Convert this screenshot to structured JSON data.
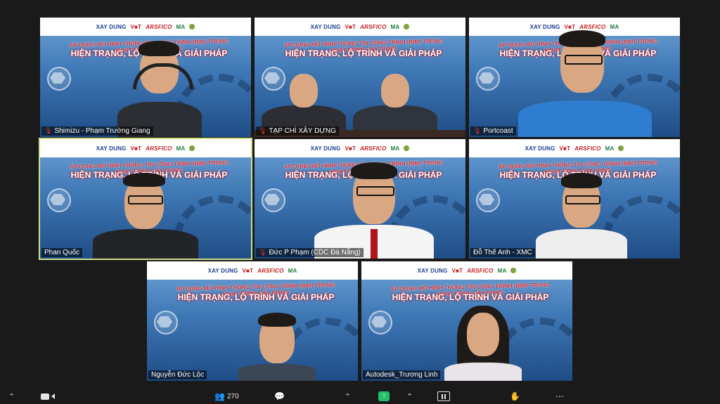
{
  "banner": {
    "logo_xd": "XAY DUNG",
    "logo_vt": "V■T",
    "logo_ar": "ARSFICO",
    "logo_ma": "MA",
    "headline": "ÁP DỤNG MÔ HÌNH THÔNG TIN CÔNG TRÌNH (BIM) TRONG HOẠT ĐỘNG XÂY DỰNG",
    "subline": "HIỆN TRẠNG, LỘ TRÌNH VÀ GIẢI PHÁP"
  },
  "participants": [
    {
      "name": "Shimizu - Phạm Trường Giang",
      "muted": true
    },
    {
      "name": "TẠP CHÍ XÂY DỰNG",
      "muted": true
    },
    {
      "name": "Portcoast",
      "muted": true
    },
    {
      "name": "Phan Quốc",
      "muted": false
    },
    {
      "name": "Đức P Phạm (CDC Đà Nẵng)",
      "muted": true
    },
    {
      "name": "Đỗ Thế Anh - XMC",
      "muted": false
    },
    {
      "name": "Nguyễn Đức Lộc",
      "muted": false
    },
    {
      "name": "Autodesk_Trương Linh",
      "muted": false
    }
  ],
  "toolbar": {
    "participants_count": "270",
    "icons": [
      "chevron-up-icon",
      "video-icon",
      "participants-icon",
      "chat-icon",
      "share-screen-icon",
      "record-icon",
      "hand-icon",
      "more-icon"
    ]
  }
}
